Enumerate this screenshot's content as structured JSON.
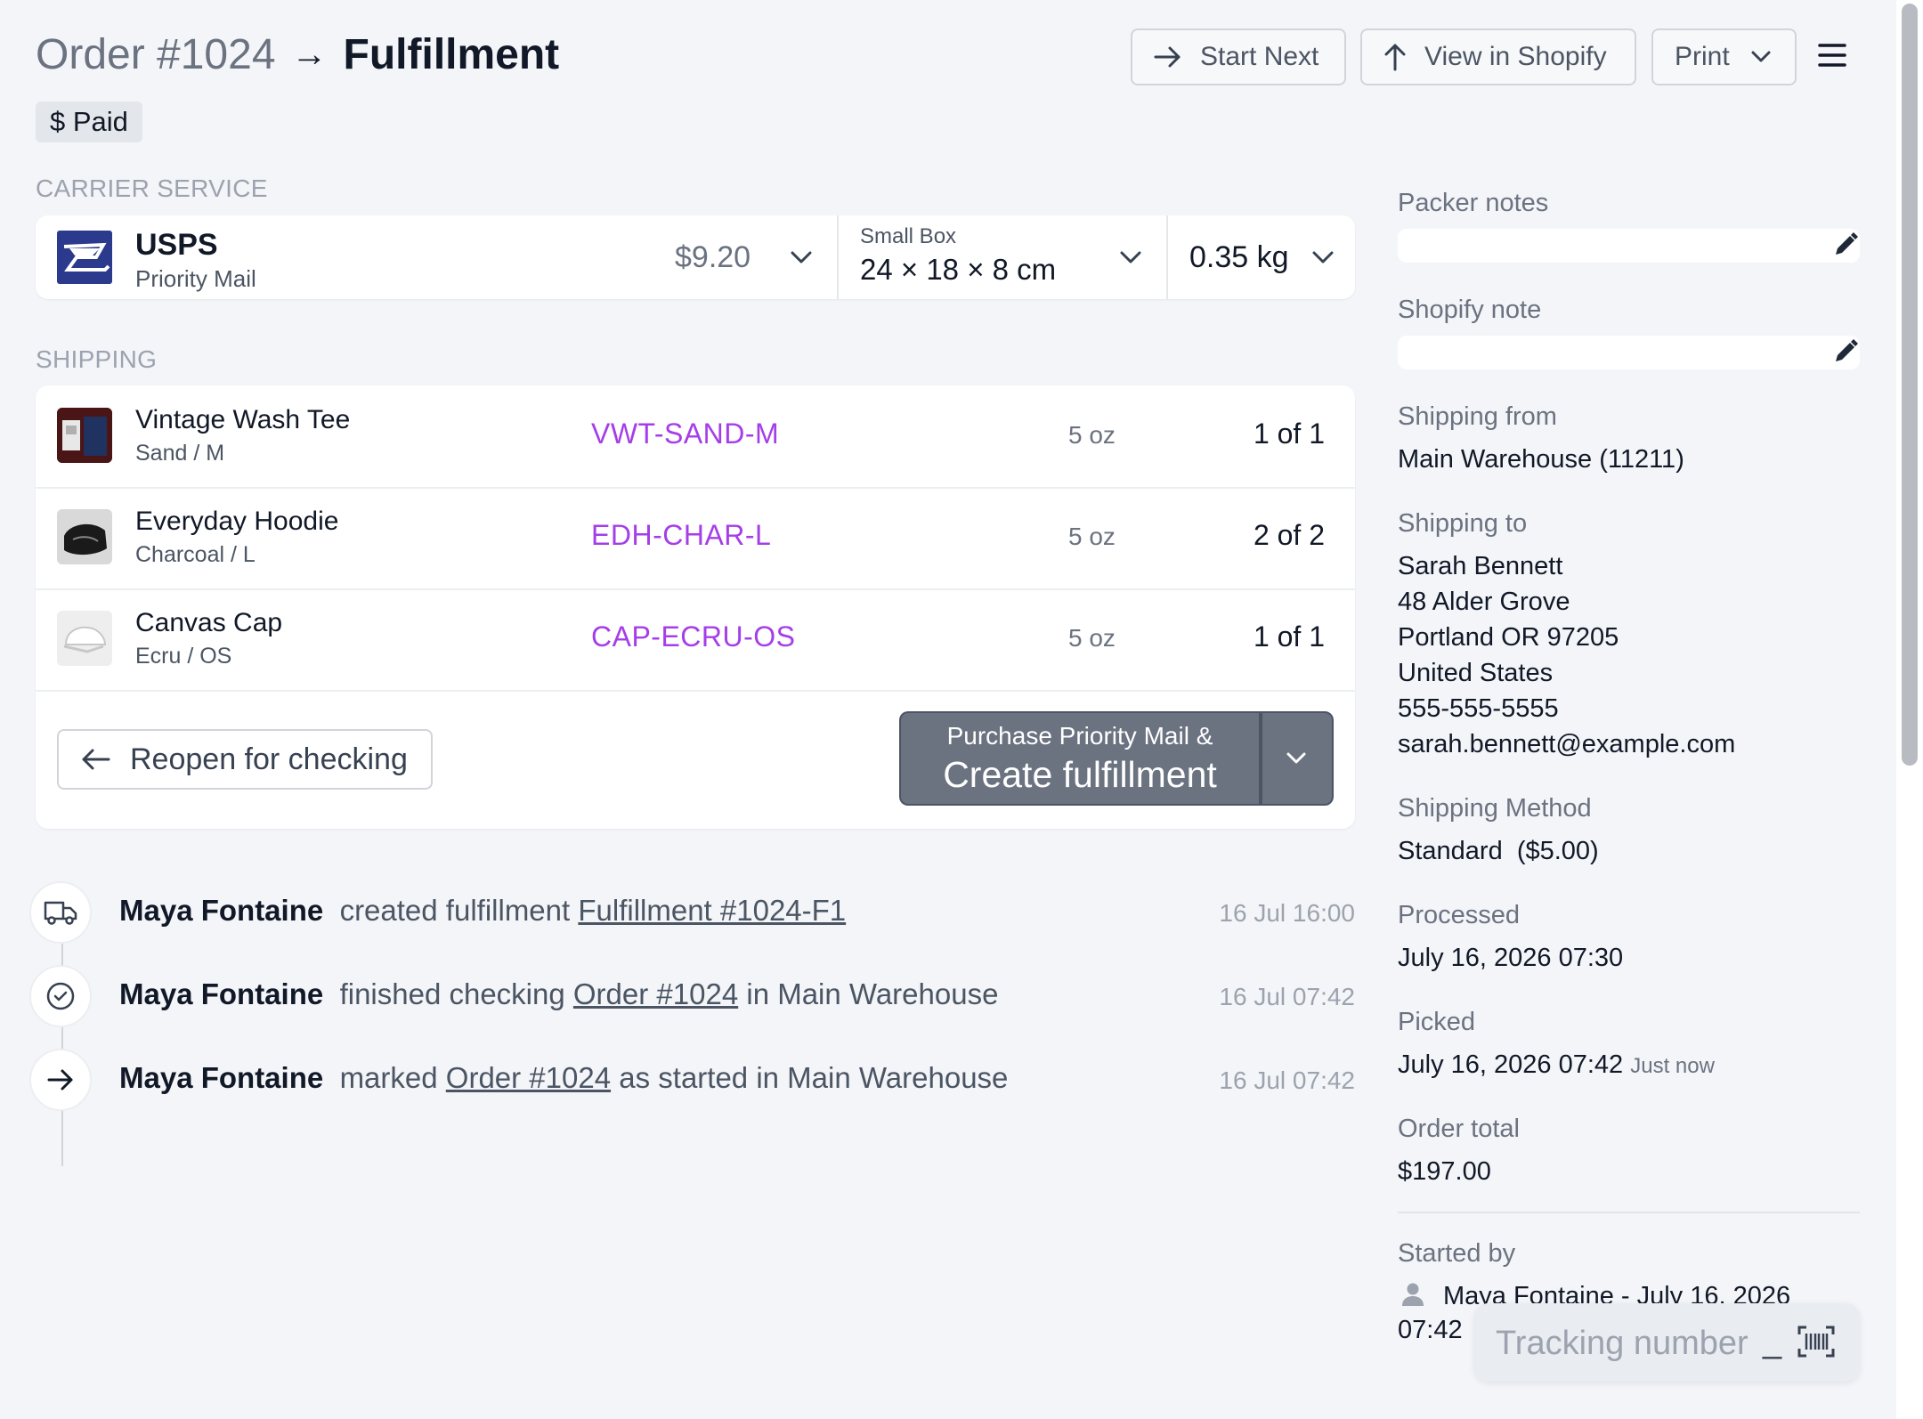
{
  "header": {
    "order_label": "Order #1024",
    "arrow": "→",
    "page_title": "Fulfillment",
    "start_next_label": "Start Next",
    "view_shopify_label": "View in Shopify",
    "print_label": "Print",
    "paid_badge": "$ Paid"
  },
  "carrier": {
    "section_label": "CARRIER SERVICE",
    "carrier_name": "USPS",
    "service_name": "Priority Mail",
    "price": "$9.20",
    "box_label": "Small Box",
    "box_dims": "24 × 18 × 8 cm",
    "weight": "0.35 kg"
  },
  "shipping": {
    "section_label": "SHIPPING",
    "items": [
      {
        "name": "Vintage Wash Tee",
        "variant": "Sand / M",
        "sku": "VWT-SAND-M",
        "weight": "5 oz",
        "qty": "1 of 1"
      },
      {
        "name": "Everyday Hoodie",
        "variant": "Charcoal / L",
        "sku": "EDH-CHAR-L",
        "weight": "5 oz",
        "qty": "2 of 2"
      },
      {
        "name": "Canvas Cap",
        "variant": "Ecru / OS",
        "sku": "CAP-ECRU-OS",
        "weight": "5 oz",
        "qty": "1 of 1"
      }
    ],
    "reopen_label": "Reopen for checking",
    "purchase_line": "Purchase Priority Mail &",
    "create_label": "Create fulfillment"
  },
  "timeline": [
    {
      "icon": "truck-icon",
      "user": "Maya Fontaine",
      "pre": "created fulfillment",
      "link": "Fulfillment #1024-F1",
      "post": "",
      "time": "16 Jul 16:00"
    },
    {
      "icon": "check-circle-icon",
      "user": "Maya Fontaine",
      "pre": "finished checking",
      "link": "Order #1024",
      "post": "in Main Warehouse",
      "time": "16 Jul 07:42"
    },
    {
      "icon": "arrow-right-icon",
      "user": "Maya Fontaine",
      "pre": "marked",
      "link": "Order #1024",
      "post": "as started in Main Warehouse",
      "time": "16 Jul 07:42"
    }
  ],
  "sidebar": {
    "packer_notes_label": "Packer notes",
    "shopify_note_label": "Shopify note",
    "shipping_from_label": "Shipping from",
    "shipping_from_value": "Main Warehouse (11211)",
    "shipping_to_label": "Shipping to",
    "shipping_to_lines": [
      "Sarah Bennett",
      "48 Alder Grove",
      "Portland OR 97205",
      "United States",
      "555-555-5555",
      "sarah.bennett@example.com"
    ],
    "shipping_method_label": "Shipping Method",
    "shipping_method_value": "Standard  ($5.00)",
    "processed_label": "Processed",
    "processed_value": "July 16, 2026 07:30",
    "picked_label": "Picked",
    "picked_value": "July 16, 2026 07:42",
    "picked_relative": "Just now",
    "order_total_label": "Order total",
    "order_total_value": "$197.00",
    "started_by_label": "Started by",
    "started_by_value": "Maya Fontaine - July 16, 2026",
    "started_by_time": "07:42"
  },
  "tracking": {
    "placeholder": "Tracking number",
    "cursor": "_"
  },
  "colors": {
    "sku_purple": "#a53ee8",
    "primary_button": "#6b7280",
    "background": "#f3f5f8"
  }
}
